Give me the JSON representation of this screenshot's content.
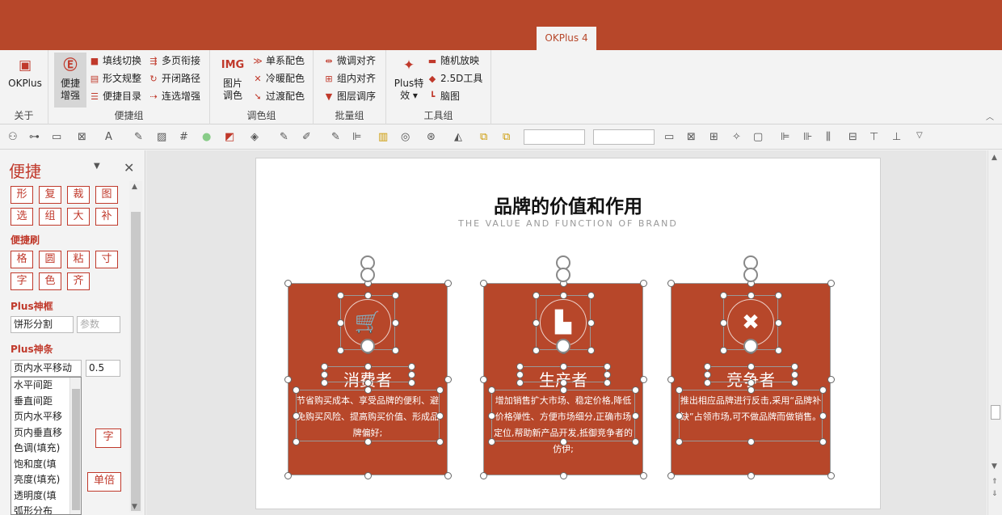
{
  "app": {
    "tab": "OKPlus 4"
  },
  "ribbon": {
    "about": {
      "label": "OKPlus",
      "group": "关于",
      "icon": "okplus-logo-icon"
    },
    "bianjie": {
      "group": "便捷组",
      "big": "便捷\n增强",
      "items": [
        "填线切换",
        "形文规整",
        "便捷目录",
        "多页衔接",
        "开闭路径",
        "连选增强"
      ]
    },
    "color": {
      "group": "调色组",
      "big": "图片\n调色",
      "big_icon": "IMG",
      "items": [
        "单系配色",
        "冷暖配色",
        "过渡配色"
      ]
    },
    "batch": {
      "group": "批量组",
      "items": [
        "微调对齐",
        "组内对齐",
        "图层调序"
      ]
    },
    "tools": {
      "group": "工具组",
      "big": "Plus特\n效 ▾",
      "items": [
        "随机放映",
        "2.5D工具",
        "脑图"
      ]
    }
  },
  "pane": {
    "title": "便捷",
    "row1": [
      "形",
      "复",
      "裁",
      "图"
    ],
    "row2": [
      "选",
      "组",
      "大",
      "补"
    ],
    "brush_label": "便捷刷",
    "row3": [
      "格",
      "圆",
      "粘",
      "寸"
    ],
    "row4": [
      "字",
      "色",
      "齐"
    ],
    "frame_label": "Plus神框",
    "frame_value": "饼形分割",
    "frame_placeholder": "参数",
    "bar_label": "Plus神条",
    "bar_value": "页内水平移动",
    "bar_param": "0.5",
    "dropdown_items": [
      "水平间距",
      "垂直间距",
      "页内水平移",
      "页内垂直移",
      "色调(填充)",
      "饱和度(填",
      "亮度(填充)",
      "透明度(填",
      "弧形分布"
    ],
    "extra_btn": "字",
    "unit_btn": "单倍"
  },
  "slide": {
    "title": "品牌的价值和作用",
    "subtitle": "THE VALUE AND FUNCTION OF BRAND",
    "cards": [
      {
        "title": "消费者",
        "icon": "cart-icon",
        "text": "节省购买成本、享受品牌的便利、避免购买风险、提高购买价值、形成品牌偏好;"
      },
      {
        "title": "生产者",
        "icon": "factory-icon",
        "text": "增加销售扩大市场、稳定价格,降低价格弹性、方便市场细分,正确市场定位,帮助新产品开发,抵御竞争者的仿伊;"
      },
      {
        "title": "竞争者",
        "icon": "crossed-swords-icon",
        "text": "推出相应品牌进行反击,采用“品牌补缺”占领市场,可不做品牌而做销售。"
      }
    ]
  },
  "colors": {
    "accent": "#b7472a",
    "ribbon_bg": "#f3f3f3"
  }
}
